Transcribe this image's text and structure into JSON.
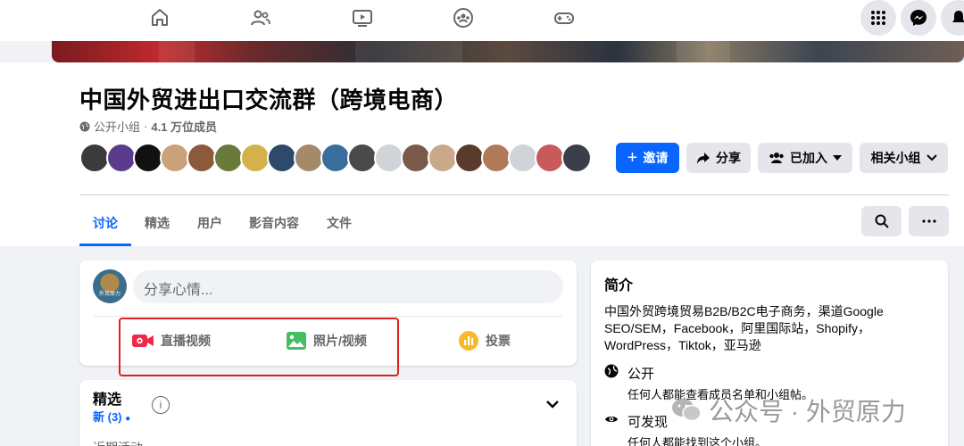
{
  "nav": {
    "icons": [
      "home-icon",
      "friends-icon",
      "video-icon",
      "groups-icon",
      "gaming-icon",
      "menu-grid-icon",
      "messenger-icon",
      "bell-icon"
    ]
  },
  "group": {
    "title": "中国外贸进出口交流群（跨境电商）",
    "privacy": "公开小组",
    "members": "4.1 万位成员"
  },
  "buttons": {
    "invite": "邀请",
    "share": "分享",
    "joined": "已加入",
    "related": "相关小组"
  },
  "tabs": [
    "讨论",
    "精选",
    "用户",
    "影音内容",
    "文件"
  ],
  "composer": {
    "placeholder": "分享心情...",
    "avatar_text": "外贸原力",
    "actions": {
      "live": "直播视频",
      "photo": "照片/视频",
      "poll": "投票"
    }
  },
  "featured": {
    "title": "精选",
    "new": "新 (3)",
    "info": "i",
    "recent": "近期活动"
  },
  "intro": {
    "title": "简介",
    "description": "中国外贸跨境贸易B2B/B2C电子商务，渠道Google SEO/SEM，Facebook，阿里国际站，Shopify，WordPress，Tiktok，亚马逊",
    "public_title": "公开",
    "public_desc": "任何人都能查看成员名单和小组帖。",
    "visible_title": "可发现",
    "visible_desc": "任何人都能找到这个小组。"
  },
  "watermark": "公众号 · 外贸原力",
  "colors": {
    "accent": "#0866ff",
    "highlight_box": "#e02020"
  }
}
